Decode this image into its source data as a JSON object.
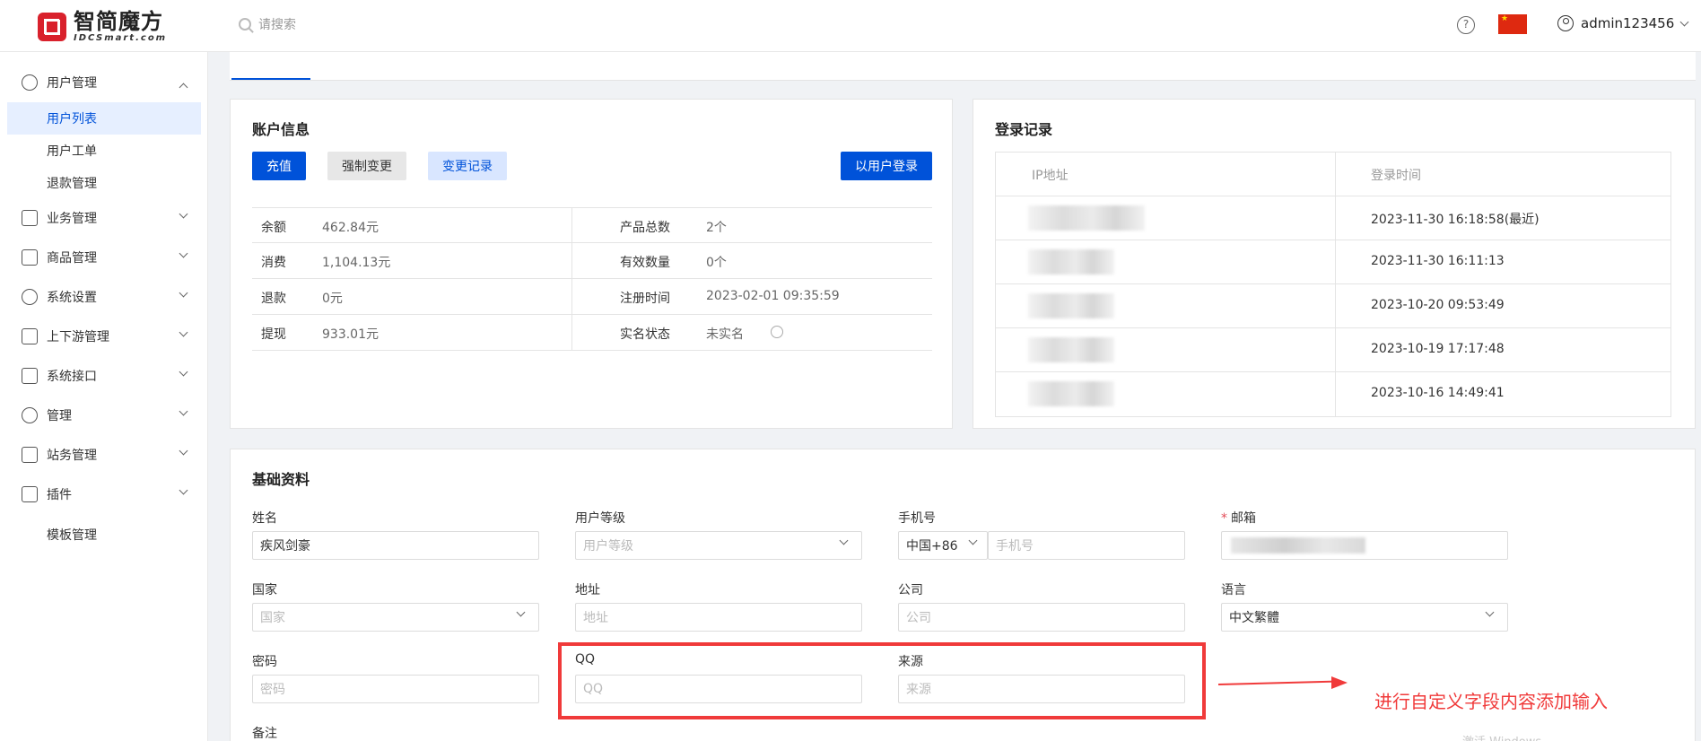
{
  "header": {
    "logo_cn": "智简魔方",
    "logo_en": "IDCSmart.com",
    "search_placeholder": "请搜索",
    "help_glyph": "?",
    "username": "admin123456"
  },
  "sidebar": {
    "user_mgmt": "用户管理",
    "sub_items": [
      "用户列表",
      "用户工单",
      "退款管理"
    ],
    "items": [
      "业务管理",
      "商品管理",
      "系统设置",
      "上下游管理",
      "系统接口",
      "管理",
      "站务管理",
      "插件"
    ],
    "template_mgmt": "模板管理"
  },
  "account": {
    "title": "账户信息",
    "buttons": {
      "recharge": "充值",
      "force_change": "强制变更",
      "change_log": "变更记录",
      "login_as": "以用户登录"
    },
    "rows": [
      {
        "k1": "余额",
        "v1": "462.84元",
        "k2": "产品总数",
        "v2": "2个"
      },
      {
        "k1": "消费",
        "v1": "1,104.13元",
        "k2": "有效数量",
        "v2": "0个"
      },
      {
        "k1": "退款",
        "v1": "0元",
        "k2": "注册时间",
        "v2": "2023-02-01 09:35:59"
      },
      {
        "k1": "提现",
        "v1": "933.01元",
        "k2": "实名状态",
        "v2": "未实名"
      }
    ]
  },
  "login_log": {
    "title": "登录记录",
    "headers": {
      "ip": "IP地址",
      "time": "登录时间"
    },
    "rows": [
      "2023-11-30 16:18:58(最近)",
      "2023-11-30 16:11:13",
      "2023-10-20 09:53:49",
      "2023-10-19 17:17:48",
      "2023-10-16 14:49:41"
    ]
  },
  "basic": {
    "title": "基础资料",
    "name_label": "姓名",
    "name_value": "疾风剑豪",
    "level_label": "用户等级",
    "level_placeholder": "用户等级",
    "phone_label": "手机号",
    "phone_code": "中国+86",
    "phone_placeholder": "手机号",
    "email_label": "邮箱",
    "required_mark": "*",
    "country_label": "国家",
    "country_placeholder": "国家",
    "address_label": "地址",
    "address_placeholder": "地址",
    "company_label": "公司",
    "company_placeholder": "公司",
    "language_label": "语言",
    "language_value": "中文繁體",
    "password_label": "密码",
    "password_placeholder": "密码",
    "qq_label": "QQ",
    "qq_placeholder": "QQ",
    "source_label": "来源",
    "source_placeholder": "来源",
    "remark_label": "备注"
  },
  "annotation": {
    "text": "进行自定义字段内容添加输入",
    "color": "#f03a3a"
  },
  "watermark": "激活 Windows",
  "colors": {
    "primary": "#0052d9",
    "active_bg": "#e6efff"
  }
}
